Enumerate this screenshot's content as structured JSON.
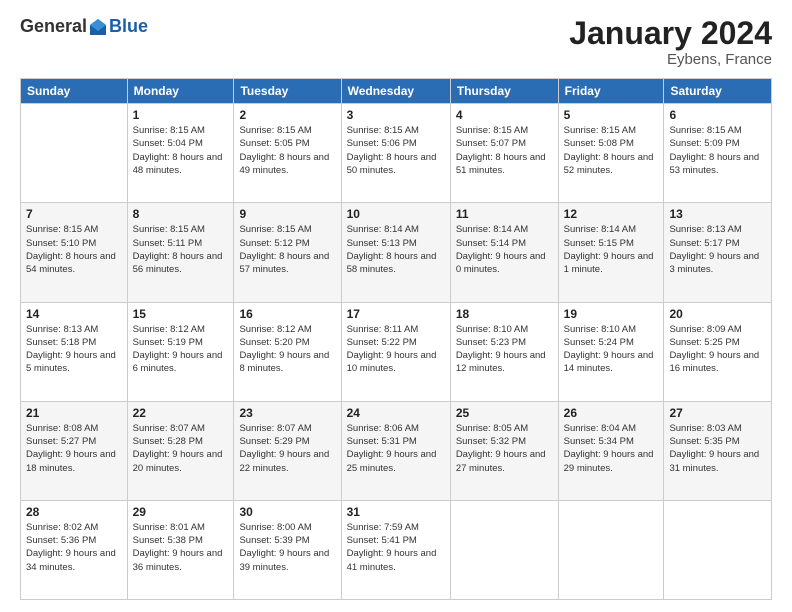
{
  "logo": {
    "general": "General",
    "blue": "Blue"
  },
  "header": {
    "month": "January 2024",
    "location": "Eybens, France"
  },
  "weekdays": [
    "Sunday",
    "Monday",
    "Tuesday",
    "Wednesday",
    "Thursday",
    "Friday",
    "Saturday"
  ],
  "weeks": [
    [
      {
        "day": "",
        "sunrise": "",
        "sunset": "",
        "daylight": ""
      },
      {
        "day": "1",
        "sunrise": "Sunrise: 8:15 AM",
        "sunset": "Sunset: 5:04 PM",
        "daylight": "Daylight: 8 hours and 48 minutes."
      },
      {
        "day": "2",
        "sunrise": "Sunrise: 8:15 AM",
        "sunset": "Sunset: 5:05 PM",
        "daylight": "Daylight: 8 hours and 49 minutes."
      },
      {
        "day": "3",
        "sunrise": "Sunrise: 8:15 AM",
        "sunset": "Sunset: 5:06 PM",
        "daylight": "Daylight: 8 hours and 50 minutes."
      },
      {
        "day": "4",
        "sunrise": "Sunrise: 8:15 AM",
        "sunset": "Sunset: 5:07 PM",
        "daylight": "Daylight: 8 hours and 51 minutes."
      },
      {
        "day": "5",
        "sunrise": "Sunrise: 8:15 AM",
        "sunset": "Sunset: 5:08 PM",
        "daylight": "Daylight: 8 hours and 52 minutes."
      },
      {
        "day": "6",
        "sunrise": "Sunrise: 8:15 AM",
        "sunset": "Sunset: 5:09 PM",
        "daylight": "Daylight: 8 hours and 53 minutes."
      }
    ],
    [
      {
        "day": "7",
        "sunrise": "Sunrise: 8:15 AM",
        "sunset": "Sunset: 5:10 PM",
        "daylight": "Daylight: 8 hours and 54 minutes."
      },
      {
        "day": "8",
        "sunrise": "Sunrise: 8:15 AM",
        "sunset": "Sunset: 5:11 PM",
        "daylight": "Daylight: 8 hours and 56 minutes."
      },
      {
        "day": "9",
        "sunrise": "Sunrise: 8:15 AM",
        "sunset": "Sunset: 5:12 PM",
        "daylight": "Daylight: 8 hours and 57 minutes."
      },
      {
        "day": "10",
        "sunrise": "Sunrise: 8:14 AM",
        "sunset": "Sunset: 5:13 PM",
        "daylight": "Daylight: 8 hours and 58 minutes."
      },
      {
        "day": "11",
        "sunrise": "Sunrise: 8:14 AM",
        "sunset": "Sunset: 5:14 PM",
        "daylight": "Daylight: 9 hours and 0 minutes."
      },
      {
        "day": "12",
        "sunrise": "Sunrise: 8:14 AM",
        "sunset": "Sunset: 5:15 PM",
        "daylight": "Daylight: 9 hours and 1 minute."
      },
      {
        "day": "13",
        "sunrise": "Sunrise: 8:13 AM",
        "sunset": "Sunset: 5:17 PM",
        "daylight": "Daylight: 9 hours and 3 minutes."
      }
    ],
    [
      {
        "day": "14",
        "sunrise": "Sunrise: 8:13 AM",
        "sunset": "Sunset: 5:18 PM",
        "daylight": "Daylight: 9 hours and 5 minutes."
      },
      {
        "day": "15",
        "sunrise": "Sunrise: 8:12 AM",
        "sunset": "Sunset: 5:19 PM",
        "daylight": "Daylight: 9 hours and 6 minutes."
      },
      {
        "day": "16",
        "sunrise": "Sunrise: 8:12 AM",
        "sunset": "Sunset: 5:20 PM",
        "daylight": "Daylight: 9 hours and 8 minutes."
      },
      {
        "day": "17",
        "sunrise": "Sunrise: 8:11 AM",
        "sunset": "Sunset: 5:22 PM",
        "daylight": "Daylight: 9 hours and 10 minutes."
      },
      {
        "day": "18",
        "sunrise": "Sunrise: 8:10 AM",
        "sunset": "Sunset: 5:23 PM",
        "daylight": "Daylight: 9 hours and 12 minutes."
      },
      {
        "day": "19",
        "sunrise": "Sunrise: 8:10 AM",
        "sunset": "Sunset: 5:24 PM",
        "daylight": "Daylight: 9 hours and 14 minutes."
      },
      {
        "day": "20",
        "sunrise": "Sunrise: 8:09 AM",
        "sunset": "Sunset: 5:25 PM",
        "daylight": "Daylight: 9 hours and 16 minutes."
      }
    ],
    [
      {
        "day": "21",
        "sunrise": "Sunrise: 8:08 AM",
        "sunset": "Sunset: 5:27 PM",
        "daylight": "Daylight: 9 hours and 18 minutes."
      },
      {
        "day": "22",
        "sunrise": "Sunrise: 8:07 AM",
        "sunset": "Sunset: 5:28 PM",
        "daylight": "Daylight: 9 hours and 20 minutes."
      },
      {
        "day": "23",
        "sunrise": "Sunrise: 8:07 AM",
        "sunset": "Sunset: 5:29 PM",
        "daylight": "Daylight: 9 hours and 22 minutes."
      },
      {
        "day": "24",
        "sunrise": "Sunrise: 8:06 AM",
        "sunset": "Sunset: 5:31 PM",
        "daylight": "Daylight: 9 hours and 25 minutes."
      },
      {
        "day": "25",
        "sunrise": "Sunrise: 8:05 AM",
        "sunset": "Sunset: 5:32 PM",
        "daylight": "Daylight: 9 hours and 27 minutes."
      },
      {
        "day": "26",
        "sunrise": "Sunrise: 8:04 AM",
        "sunset": "Sunset: 5:34 PM",
        "daylight": "Daylight: 9 hours and 29 minutes."
      },
      {
        "day": "27",
        "sunrise": "Sunrise: 8:03 AM",
        "sunset": "Sunset: 5:35 PM",
        "daylight": "Daylight: 9 hours and 31 minutes."
      }
    ],
    [
      {
        "day": "28",
        "sunrise": "Sunrise: 8:02 AM",
        "sunset": "Sunset: 5:36 PM",
        "daylight": "Daylight: 9 hours and 34 minutes."
      },
      {
        "day": "29",
        "sunrise": "Sunrise: 8:01 AM",
        "sunset": "Sunset: 5:38 PM",
        "daylight": "Daylight: 9 hours and 36 minutes."
      },
      {
        "day": "30",
        "sunrise": "Sunrise: 8:00 AM",
        "sunset": "Sunset: 5:39 PM",
        "daylight": "Daylight: 9 hours and 39 minutes."
      },
      {
        "day": "31",
        "sunrise": "Sunrise: 7:59 AM",
        "sunset": "Sunset: 5:41 PM",
        "daylight": "Daylight: 9 hours and 41 minutes."
      },
      {
        "day": "",
        "sunrise": "",
        "sunset": "",
        "daylight": ""
      },
      {
        "day": "",
        "sunrise": "",
        "sunset": "",
        "daylight": ""
      },
      {
        "day": "",
        "sunrise": "",
        "sunset": "",
        "daylight": ""
      }
    ]
  ]
}
